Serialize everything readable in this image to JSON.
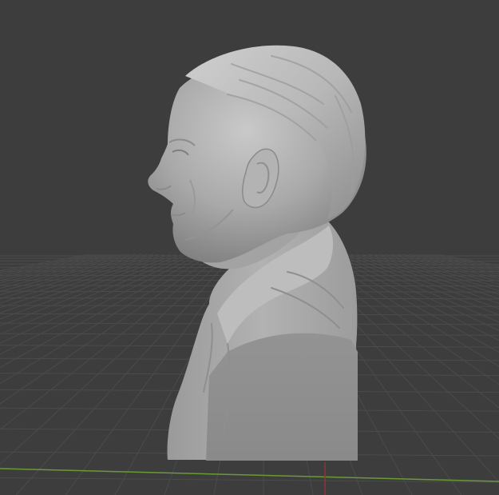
{
  "app": {
    "kind": "3d-viewport"
  },
  "viewport": {
    "background_color": "#3d3d3d",
    "grid_color": "#4a4a4a",
    "x_axis_color": "#8a3838",
    "y_axis_color": "#6a9a34"
  },
  "scene": {
    "object": "sculpted-head-bust-model",
    "material_color": "#a8a8a8",
    "view": "side-profile"
  }
}
